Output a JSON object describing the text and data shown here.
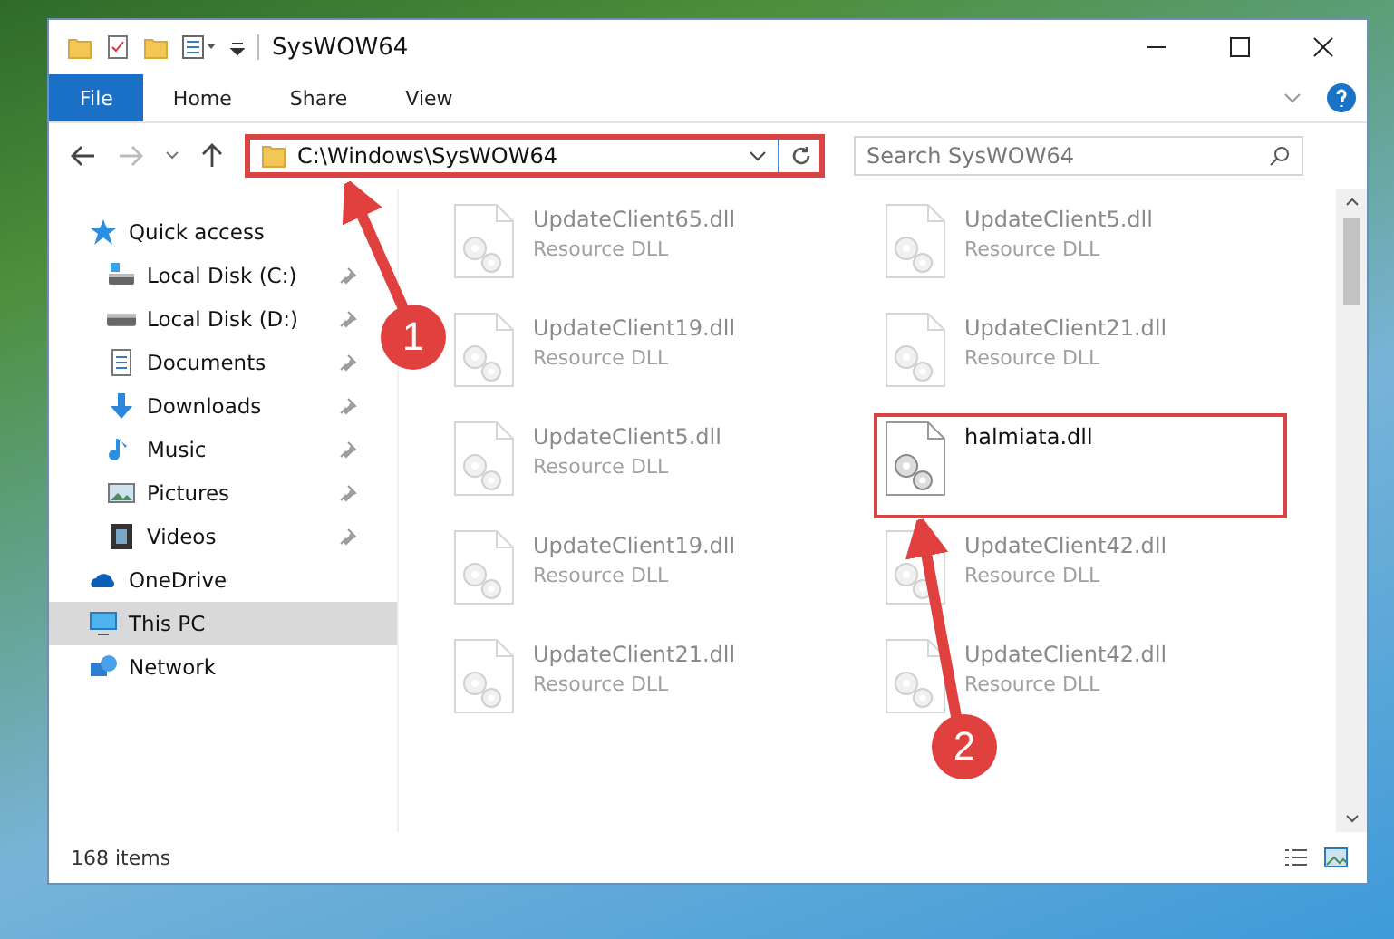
{
  "window": {
    "title": "SysWOW64"
  },
  "ribbon_tabs": [
    {
      "label": "File",
      "selected": true
    },
    {
      "label": "Home",
      "selected": false
    },
    {
      "label": "Share",
      "selected": false
    },
    {
      "label": "View",
      "selected": false
    }
  ],
  "address_bar": {
    "path": "C:\\Windows\\SysWOW64",
    "highlighted": true
  },
  "search": {
    "placeholder": "Search SysWOW64"
  },
  "sidebar": {
    "items": [
      {
        "label": "Quick access",
        "kind": "star",
        "selected": false,
        "children": [
          {
            "label": "Local Disk (C:)",
            "kind": "disk-c",
            "pinned": true,
            "selected": false
          },
          {
            "label": "Local Disk (D:)",
            "kind": "disk",
            "pinned": true,
            "selected": false
          },
          {
            "label": "Documents",
            "kind": "doc",
            "pinned": true,
            "selected": false
          },
          {
            "label": "Downloads",
            "kind": "download",
            "pinned": true,
            "selected": false
          },
          {
            "label": "Music",
            "kind": "music",
            "pinned": true,
            "selected": false
          },
          {
            "label": "Pictures",
            "kind": "picture",
            "pinned": true,
            "selected": false
          },
          {
            "label": "Videos",
            "kind": "video",
            "pinned": true,
            "selected": false
          }
        ]
      },
      {
        "label": "OneDrive",
        "kind": "cloud",
        "selected": false
      },
      {
        "label": "This PC",
        "kind": "pc",
        "selected": true
      },
      {
        "label": "Network",
        "kind": "network",
        "selected": false
      }
    ]
  },
  "files": [
    {
      "name": "UpdateClient65.dll",
      "type": "Resource DLL",
      "dimmed": true,
      "highlighted": false
    },
    {
      "name": "UpdateClient5.dll",
      "type": "Resource DLL",
      "dimmed": true,
      "highlighted": false
    },
    {
      "name": "UpdateClient19.dll",
      "type": "Resource DLL",
      "dimmed": true,
      "highlighted": false
    },
    {
      "name": "UpdateClient21.dll",
      "type": "Resource DLL",
      "dimmed": true,
      "highlighted": false
    },
    {
      "name": "UpdateClient5.dll",
      "type": "Resource DLL",
      "dimmed": true,
      "highlighted": false
    },
    {
      "name": "halmiata.dll",
      "dimmed": false,
      "highlighted": true
    },
    {
      "name": "UpdateClient19.dll",
      "type": "Resource DLL",
      "dimmed": true,
      "highlighted": false
    },
    {
      "name": "UpdateClient42.dll",
      "type": "Resource DLL",
      "dimmed": true,
      "highlighted": false
    },
    {
      "name": "UpdateClient21.dll",
      "type": "Resource DLL",
      "dimmed": true,
      "highlighted": false
    },
    {
      "name": "UpdateClient42.dll",
      "type": "Resource DLL",
      "dimmed": true,
      "highlighted": false
    }
  ],
  "status_bar": {
    "item_count": "168 items"
  },
  "annotations": [
    {
      "number": "1"
    },
    {
      "number": "2"
    }
  ]
}
